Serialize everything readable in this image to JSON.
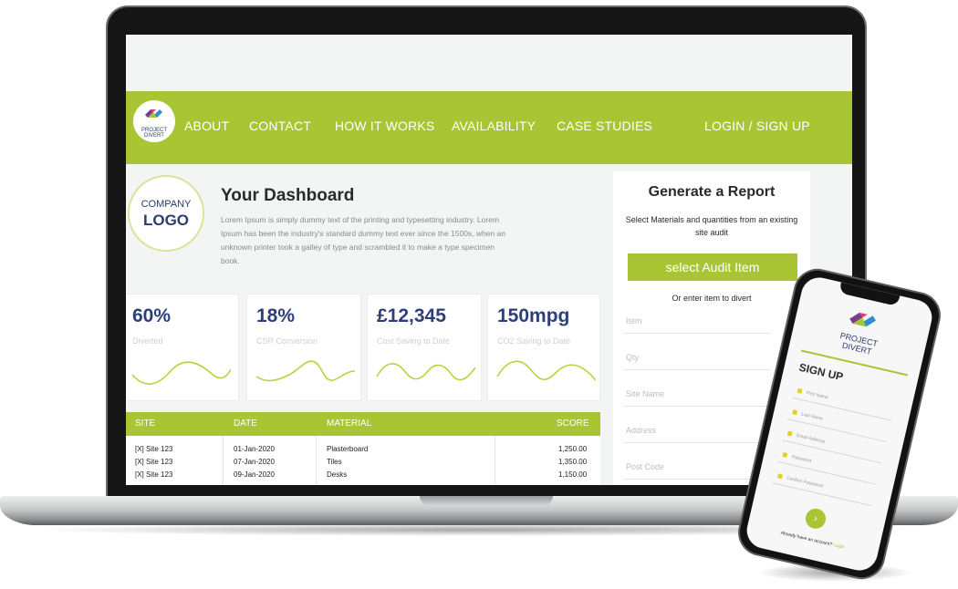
{
  "nav": {
    "brand": [
      "PROJECT",
      "DIVERT"
    ],
    "items": [
      "ABOUT",
      "CONTACT",
      "HOW IT WORKS",
      "AVAILABILITY",
      "CASE STUDIES"
    ],
    "login": "LOGIN / SIGN UP"
  },
  "company_logo": {
    "line1": "COMPANY",
    "line2": "LOGO"
  },
  "dashboard": {
    "title": "Your Dashboard",
    "description": "Lorem Ipsum is simply dummy text of the printing and typesetting industry. Lorem Ipsum has been the industry's standard dummy text ever since the 1500s, when an unknown printer took a galley of type and scrambled it to make a type specimen book."
  },
  "stats": [
    {
      "value": "60%",
      "label": "Diverted"
    },
    {
      "value": "18%",
      "label": "CSR Conversion"
    },
    {
      "value": "£12,345",
      "label": "Cost Saving to Date"
    },
    {
      "value": "150mpg",
      "label": "CO2 Saving to Date"
    }
  ],
  "table": {
    "headers": [
      "SITE",
      "DATE",
      "MATERIAL",
      "SCORE"
    ],
    "rows": [
      {
        "site": "[X] Site 123",
        "date": "01-Jan-2020",
        "material": "Plasterboard",
        "score": "1,250.00"
      },
      {
        "site": "[X] Site 123",
        "date": "07-Jan-2020",
        "material": "Tiles",
        "score": "1,350.00"
      },
      {
        "site": "[X] Site 123",
        "date": "09-Jan-2020",
        "material": "Desks",
        "score": "1,150.00"
      }
    ]
  },
  "report": {
    "title": "Generate a Report",
    "subtitle": "Select Materials and quantities from an existing site audit",
    "button": "select Audit Item",
    "or_text": "Or enter item to divert",
    "fields": [
      "Item",
      "Qty",
      "Site Name",
      "Address",
      "Post Code"
    ]
  },
  "phone": {
    "brand": [
      "PROJECT",
      "DIVERT"
    ],
    "title": "SIGN UP",
    "fields": [
      "First Name",
      "Last Name",
      "Email Address",
      "Password",
      "Confirm Password"
    ],
    "submit_icon": "chevron-right-icon",
    "footer_text": "Already have an account?",
    "footer_link": "Login"
  },
  "colors": {
    "accent": "#a9c534",
    "navy": "#2d3f7a"
  }
}
